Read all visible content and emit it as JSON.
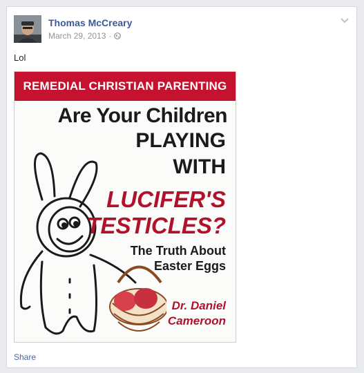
{
  "post": {
    "author": "Thomas McCreary",
    "date": "March 29, 2013",
    "separator": "·",
    "text": "Lol",
    "share_label": "Share"
  },
  "image": {
    "banner": "REMEDIAL CHRISTIAN PARENTING",
    "line1": "Are Your Children",
    "line2": "PLAYING",
    "line3": "WITH",
    "line4": "LUCIFER'S",
    "line5": "TESTICLES?",
    "sub1": "The Truth About",
    "sub2": "Easter Eggs",
    "author1": "Dr. Daniel",
    "author2": "Cameroon"
  },
  "colors": {
    "link": "#3b5998",
    "banner": "#c4122f",
    "accent_text": "#b0112b"
  }
}
